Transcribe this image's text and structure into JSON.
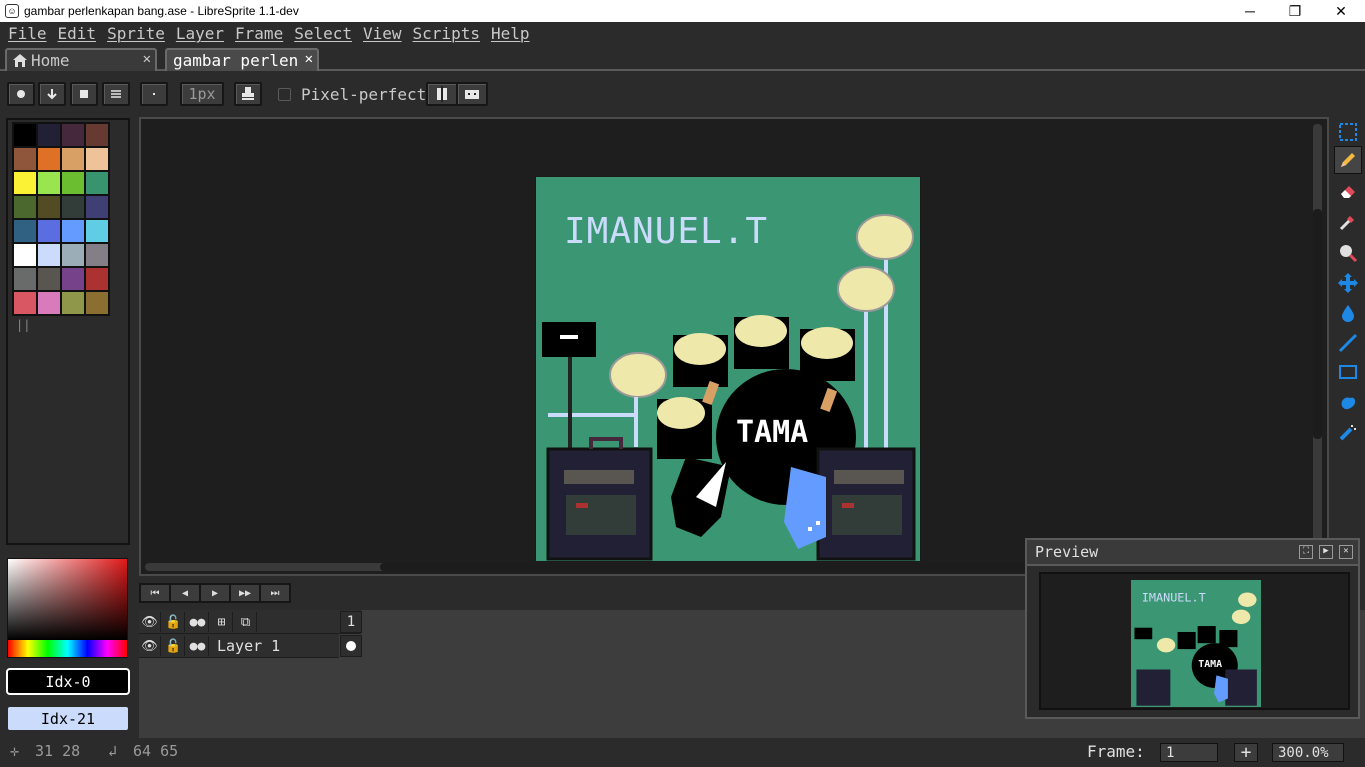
{
  "window": {
    "title": "gambar perlenkapan bang.ase - LibreSprite 1.1-dev",
    "minimize_glyph": "─",
    "restore_glyph": "❐",
    "close_glyph": "✕"
  },
  "menu": [
    "File",
    "Edit",
    "Sprite",
    "Layer",
    "Frame",
    "Select",
    "View",
    "Scripts",
    "Help"
  ],
  "tabs": [
    {
      "label": "Home",
      "close": "✕",
      "icon": "home-icon"
    },
    {
      "label": "gambar perlen",
      "close": "✕"
    }
  ],
  "context_bar": {
    "brush_size": "1px",
    "pixel_perfect_label": "Pixel-perfect",
    "pixel_perfect_checked": false
  },
  "palette": {
    "colors": [
      "#000000",
      "#222034",
      "#45283c",
      "#663931",
      "#8f563b",
      "#df7126",
      "#d9a066",
      "#eec39a",
      "#fbf236",
      "#99e550",
      "#6abe30",
      "#37946e",
      "#4b692f",
      "#524b24",
      "#323c39",
      "#3f3f74",
      "#306082",
      "#5b6ee1",
      "#639bff",
      "#5fcde4",
      "#ffffff",
      "#cbdbfc",
      "#9badb7",
      "#847e87",
      "#696a6a",
      "#595652",
      "#76428a",
      "#ac3232",
      "#d95763",
      "#d77bba",
      "#8f974a",
      "#8a6f30"
    ],
    "handle": "||"
  },
  "foreground": {
    "label": "Idx-0",
    "color": "#000000"
  },
  "background": {
    "label": "Idx-21",
    "color": "#cbdbfc"
  },
  "sprite": {
    "text_top": "IMANUEL.T",
    "drum_text": "TAMA"
  },
  "timeline": {
    "buttons": [
      "⏮",
      "◀",
      "▶",
      "▶▶",
      "⏭"
    ],
    "header_icons": [
      "eye-icon",
      "lock-icon",
      "continuous-icon",
      "layers-icon",
      "onion-icon"
    ],
    "frame_number": "1",
    "layers": [
      {
        "name": "Layer 1"
      }
    ]
  },
  "preview": {
    "title": "Preview"
  },
  "status": {
    "cursor_pos": "31 28",
    "size": "64 65",
    "frame_label": "Frame:",
    "frame_value": "1",
    "add_frame": "+",
    "zoom": "300.0%"
  },
  "colors": {
    "canvas_bg": "#3b9673",
    "panel_bg": "#2b2b2b",
    "accent_blue": "#1e88e5"
  }
}
